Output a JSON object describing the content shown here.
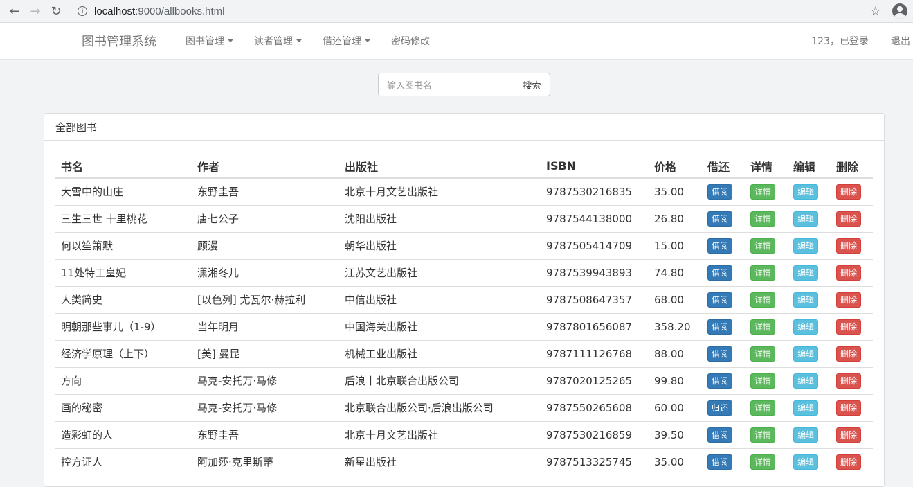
{
  "browser": {
    "url_host": "localhost",
    "url_rest": ":9000/allbooks.html"
  },
  "navbar": {
    "brand": "图书管理系统",
    "items": [
      {
        "label": "图书管理",
        "dropdown": true
      },
      {
        "label": "读者管理",
        "dropdown": true
      },
      {
        "label": "借还管理",
        "dropdown": true
      },
      {
        "label": "密码修改",
        "dropdown": false
      }
    ],
    "login_status": "123，已登录",
    "logout": "退出"
  },
  "search": {
    "placeholder": "输入图书名",
    "button": "搜索"
  },
  "panel": {
    "title": "全部图书",
    "columns": [
      "书名",
      "作者",
      "出版社",
      "ISBN",
      "价格",
      "借还",
      "详情",
      "编辑",
      "删除"
    ],
    "actions": {
      "detail": "详情",
      "edit": "编辑",
      "delete": "删除"
    },
    "rows": [
      {
        "name": "大雪中的山庄",
        "author": "东野圭吾",
        "publisher": "北京十月文艺出版社",
        "isbn": "9787530216835",
        "price": "35.00",
        "borrow": "借阅"
      },
      {
        "name": "三生三世 十里桃花",
        "author": "唐七公子",
        "publisher": "沈阳出版社",
        "isbn": "9787544138000",
        "price": "26.80",
        "borrow": "借阅"
      },
      {
        "name": "何以笙箫默",
        "author": "顾漫",
        "publisher": "朝华出版社",
        "isbn": "9787505414709",
        "price": "15.00",
        "borrow": "借阅"
      },
      {
        "name": "11处特工皇妃",
        "author": "潇湘冬儿",
        "publisher": "江苏文艺出版社",
        "isbn": "9787539943893",
        "price": "74.80",
        "borrow": "借阅"
      },
      {
        "name": "人类简史",
        "author": "[以色列] 尤瓦尔·赫拉利",
        "publisher": "中信出版社",
        "isbn": "9787508647357",
        "price": "68.00",
        "borrow": "借阅"
      },
      {
        "name": "明朝那些事儿（1-9）",
        "author": "当年明月",
        "publisher": "中国海关出版社",
        "isbn": "9787801656087",
        "price": "358.20",
        "borrow": "借阅"
      },
      {
        "name": "经济学原理（上下）",
        "author": "[美] 曼昆",
        "publisher": "机械工业出版社",
        "isbn": "9787111126768",
        "price": "88.00",
        "borrow": "借阅"
      },
      {
        "name": "方向",
        "author": "马克-安托万·马修",
        "publisher": "后浪丨北京联合出版公司",
        "isbn": "9787020125265",
        "price": "99.80",
        "borrow": "借阅"
      },
      {
        "name": "画的秘密",
        "author": "马克-安托万·马修",
        "publisher": "北京联合出版公司·后浪出版公司",
        "isbn": "9787550265608",
        "price": "60.00",
        "borrow": "归还"
      },
      {
        "name": "造彩虹的人",
        "author": "东野圭吾",
        "publisher": "北京十月文艺出版社",
        "isbn": "9787530216859",
        "price": "39.50",
        "borrow": "借阅"
      },
      {
        "name": "控方证人",
        "author": "阿加莎·克里斯蒂",
        "publisher": "新星出版社",
        "isbn": "9787513325745",
        "price": "35.00",
        "borrow": "借阅"
      }
    ]
  }
}
